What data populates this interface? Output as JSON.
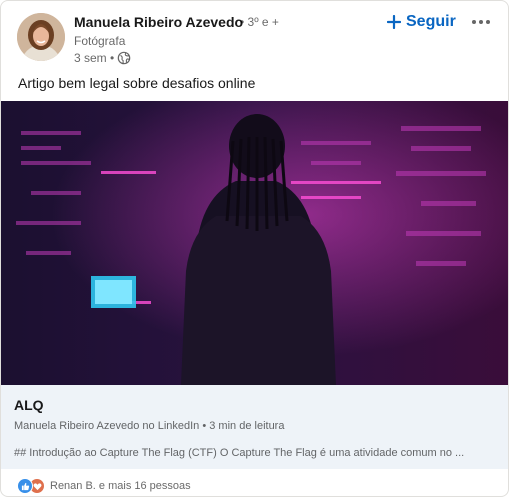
{
  "author": {
    "name": "Manuela Ribeiro Azevedo",
    "degree": "• 3º e +",
    "headline": "Fotógrafa",
    "time": "3 sem •"
  },
  "actions": {
    "follow_label": "Seguir"
  },
  "post": {
    "text": "Artigo bem legal sobre desafios online"
  },
  "article": {
    "title": "ALQ",
    "source": "Manuela Ribeiro Azevedo no LinkedIn • 3 min de leitura",
    "snippet": "## Introdução ao Capture The Flag (CTF) O Capture The Flag é uma atividade comum no ..."
  },
  "social": {
    "reactions_text": "Renan B. e mais 16 pessoas",
    "reaction_types": [
      "like",
      "love"
    ]
  },
  "icons": {
    "visibility": "globe-icon",
    "follow": "plus-icon",
    "more": "ellipsis-icon"
  },
  "colors": {
    "brand_blue": "#0a66c2",
    "article_bg": "#eef3f8",
    "like": "#378fe9",
    "love": "#df704d"
  }
}
